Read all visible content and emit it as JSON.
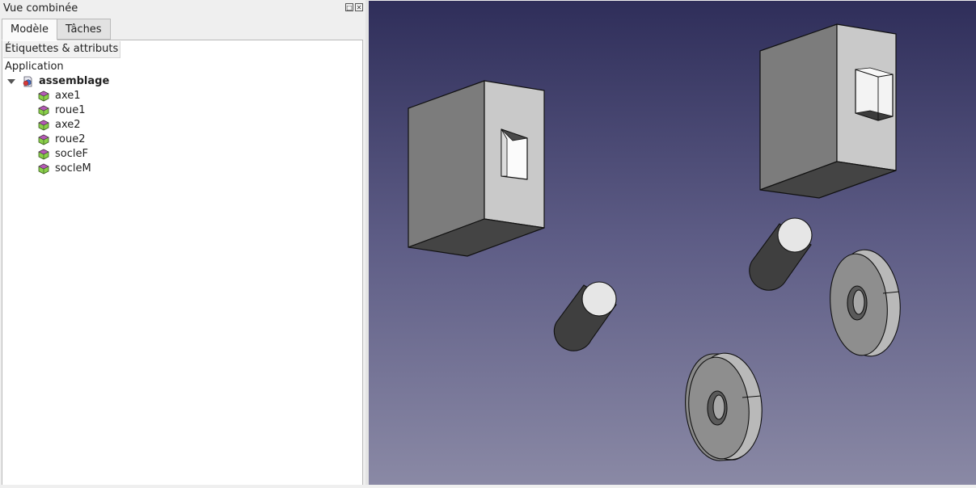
{
  "panel": {
    "title": "Vue combinée",
    "float_icon": "undock-icon",
    "close_icon": "close-icon"
  },
  "tabs": [
    {
      "label": "Modèle",
      "active": true
    },
    {
      "label": "Tâches",
      "active": false
    }
  ],
  "tree": {
    "header": "Étiquettes & attributs",
    "application_label": "Application",
    "root": {
      "label": "assemblage",
      "icon": "assembly-document-icon",
      "expanded": true
    },
    "children": [
      {
        "label": "axe1",
        "icon": "part-feature-icon"
      },
      {
        "label": "roue1",
        "icon": "part-feature-icon"
      },
      {
        "label": "axe2",
        "icon": "part-feature-icon"
      },
      {
        "label": "roue2",
        "icon": "part-feature-icon"
      },
      {
        "label": "socleF",
        "icon": "part-feature-icon"
      },
      {
        "label": "socleM",
        "icon": "part-feature-icon"
      }
    ]
  },
  "viewport": {
    "background_top": "#2f2e5a",
    "background_bottom": "#8a89a5",
    "objects": [
      "socle-block-left",
      "socle-block-right",
      "axle-cylinder-left",
      "axle-cylinder-right",
      "wheel-disk-left",
      "wheel-disk-right"
    ]
  }
}
